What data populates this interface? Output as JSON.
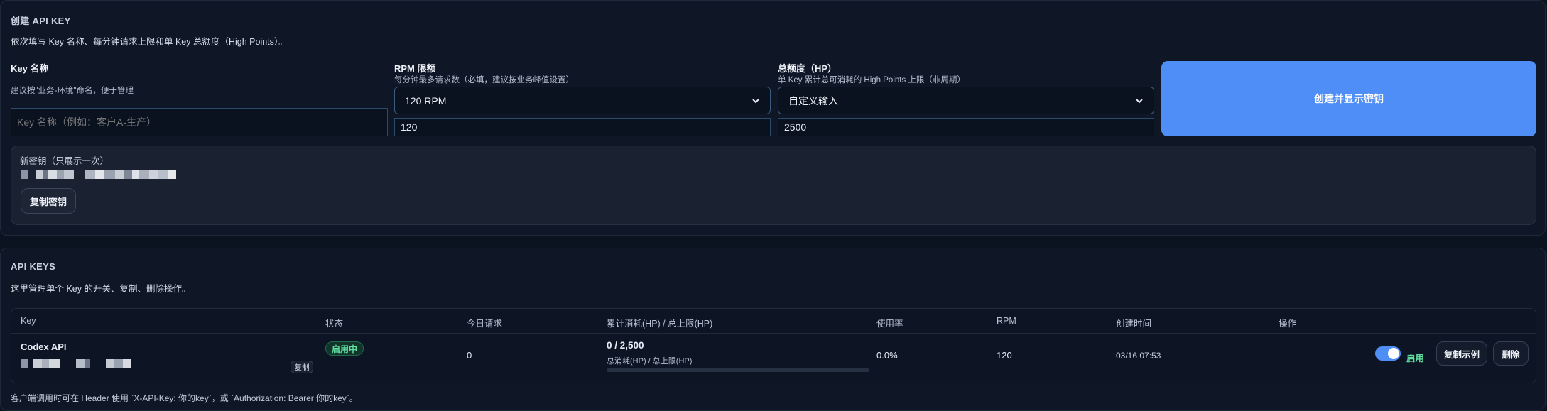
{
  "create": {
    "title": "创建 API KEY",
    "desc": "依次填写 Key 名称、每分钟请求上限和单 Key 总额度（High Points）。",
    "name_field": {
      "label": "Key 名称",
      "hint": "建议按\"业务-环境\"命名，便于管理",
      "placeholder": "Key 名称（例如：客户A-生产）"
    },
    "rpm_field": {
      "label": "RPM 限额",
      "hint": "每分钟最多请求数（必填，建议按业务峰值设置）",
      "selected": "120 RPM",
      "value": "120"
    },
    "quota_field": {
      "label": "总额度（HP）",
      "hint": "单 Key 累计总可消耗的 High Points 上限（非周期）",
      "selected": "自定义输入",
      "value": "2500"
    },
    "submit_label": "创建并显示密钥",
    "secret": {
      "label": "新密钥（只展示一次）",
      "copy_label": "复制密钥"
    }
  },
  "keys": {
    "title": "API KEYS",
    "desc": "这里管理单个 Key 的开关、复制、删除操作。",
    "columns": [
      "Key",
      "状态",
      "今日请求",
      "累计消耗(HP) / 总上限(HP)",
      "使用率",
      "RPM",
      "创建时间",
      "操作"
    ],
    "rows": [
      {
        "name": "Codex API",
        "copy_label": "复制",
        "status": "启用中",
        "today_requests": "0",
        "usage_value": "0 / 2,500",
        "usage_sub": "总消耗(HP) / 总上限(HP)",
        "usage_ratio": 0,
        "usage_rate": "0.0%",
        "rpm": "120",
        "created": "03/16 07:53",
        "toggle_label": "启用",
        "example_label": "复制示例",
        "delete_label": "删除"
      }
    ],
    "footnote": "客户端调用时可在 Header 使用 `X-API-Key: 你的key`，或 `Authorization: Bearer 你的key`。"
  },
  "colors": {
    "accent": "#4f8ef7",
    "status_green": "#5fe0a0",
    "background": "#0b1220"
  }
}
